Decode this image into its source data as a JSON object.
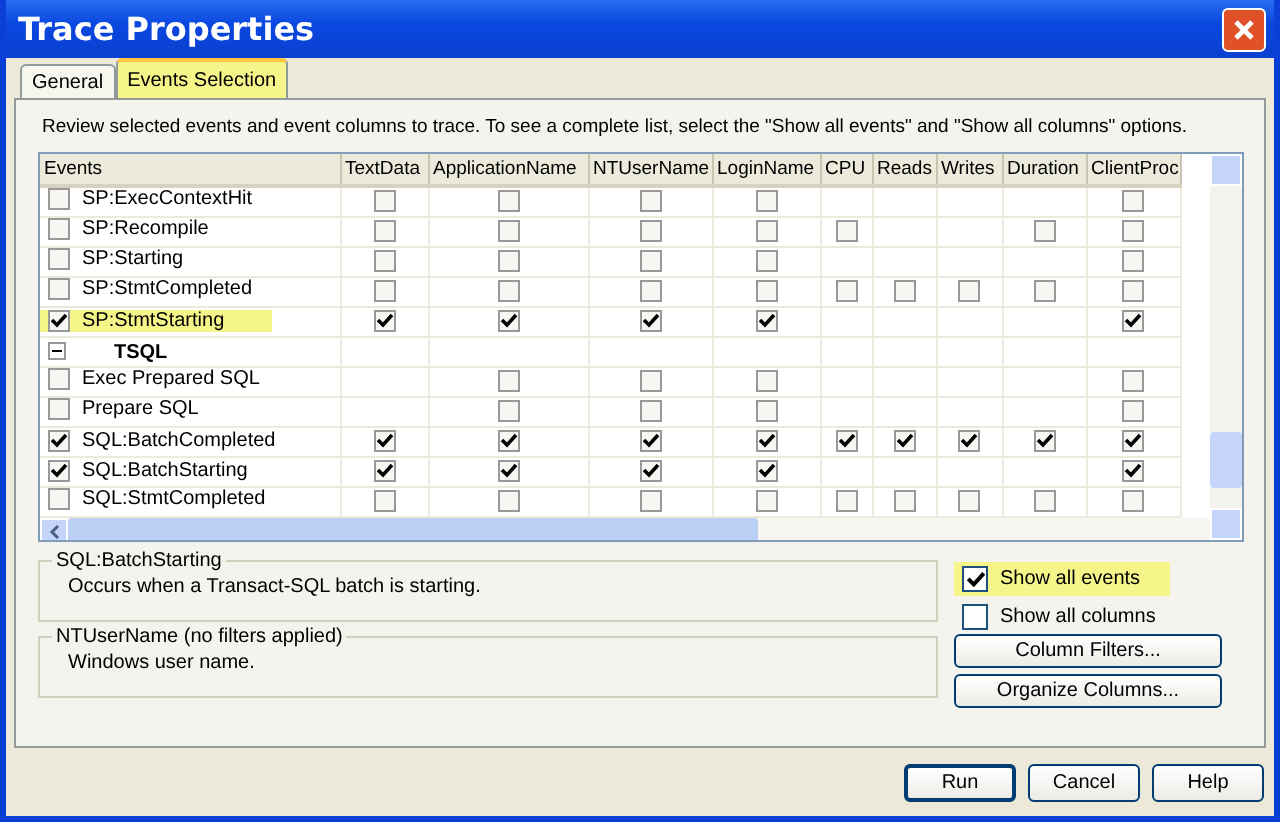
{
  "window": {
    "title": "Trace Properties"
  },
  "tabs": [
    {
      "label": "General",
      "selected": false,
      "highlighted": false
    },
    {
      "label": "Events Selection",
      "selected": true,
      "highlighted": true
    }
  ],
  "instructions": "Review selected events and event columns to trace. To see a complete list, select the \"Show all events\" and \"Show all columns\" options.",
  "grid": {
    "columns": [
      "Events",
      "TextData",
      "ApplicationName",
      "NTUserName",
      "LoginName",
      "CPU",
      "Reads",
      "Writes",
      "Duration",
      "ClientProc"
    ],
    "rows": [
      {
        "kind": "event",
        "name": "SP:ExecContextHit",
        "checked": false,
        "highlighted": false,
        "cells": [
          false,
          false,
          false,
          false,
          null,
          null,
          null,
          null,
          false
        ]
      },
      {
        "kind": "event",
        "name": "SP:Recompile",
        "checked": false,
        "highlighted": false,
        "cells": [
          false,
          false,
          false,
          false,
          false,
          null,
          null,
          false,
          false
        ]
      },
      {
        "kind": "event",
        "name": "SP:Starting",
        "checked": false,
        "highlighted": false,
        "cells": [
          false,
          false,
          false,
          false,
          null,
          null,
          null,
          null,
          false
        ]
      },
      {
        "kind": "event",
        "name": "SP:StmtCompleted",
        "checked": false,
        "highlighted": false,
        "cells": [
          false,
          false,
          false,
          false,
          false,
          false,
          false,
          false,
          false
        ]
      },
      {
        "kind": "event",
        "name": "SP:StmtStarting",
        "checked": true,
        "highlighted": true,
        "cells": [
          true,
          true,
          true,
          true,
          null,
          null,
          null,
          null,
          true
        ]
      },
      {
        "kind": "category",
        "name": "TSQL",
        "expanded": true
      },
      {
        "kind": "event",
        "name": "Exec Prepared SQL",
        "checked": false,
        "highlighted": false,
        "cells": [
          null,
          false,
          false,
          false,
          null,
          null,
          null,
          null,
          false
        ]
      },
      {
        "kind": "event",
        "name": "Prepare SQL",
        "checked": false,
        "highlighted": false,
        "cells": [
          null,
          false,
          false,
          false,
          null,
          null,
          null,
          null,
          false
        ]
      },
      {
        "kind": "event",
        "name": "SQL:BatchCompleted",
        "checked": true,
        "highlighted": false,
        "cells": [
          true,
          true,
          true,
          true,
          true,
          true,
          true,
          true,
          true
        ]
      },
      {
        "kind": "event",
        "name": "SQL:BatchStarting",
        "checked": true,
        "highlighted": false,
        "cells": [
          true,
          true,
          true,
          true,
          null,
          null,
          null,
          null,
          true
        ]
      },
      {
        "kind": "event",
        "name": "SQL:StmtCompleted",
        "checked": false,
        "highlighted": false,
        "cells": [
          false,
          false,
          false,
          false,
          false,
          false,
          false,
          false,
          false
        ]
      }
    ]
  },
  "event_info": {
    "title": "SQL:BatchStarting",
    "text": "Occurs when a Transact-SQL batch is starting."
  },
  "column_info": {
    "title": "NTUserName (no filters applied)",
    "text": "Windows user name."
  },
  "options": [
    {
      "label": "Show all events",
      "checked": true,
      "highlighted": true
    },
    {
      "label": "Show all columns",
      "checked": false,
      "highlighted": false
    }
  ],
  "side_buttons": [
    "Column Filters...",
    "Organize Columns..."
  ],
  "buttons": [
    {
      "label": "Run",
      "default": true
    },
    {
      "label": "Cancel",
      "default": false
    },
    {
      "label": "Help",
      "default": false
    }
  ]
}
